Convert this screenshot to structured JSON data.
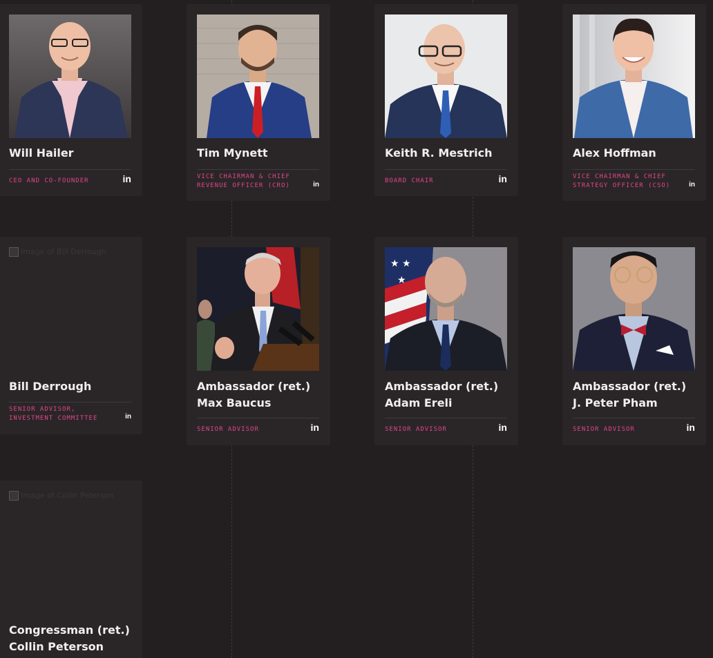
{
  "team": [
    {
      "name": "Will Hailer",
      "role": "CEO AND CO-FOUNDER",
      "linkedin": "in"
    },
    {
      "name": "Tim Mynett",
      "role": "VICE CHAIRMAN & CHIEF REVENUE OFFICER (CRO)",
      "linkedin": "in"
    },
    {
      "name": "Keith R. Mestrich",
      "role": "BOARD CHAIR",
      "linkedin": "in"
    },
    {
      "name": "Alex Hoffman",
      "role": "VICE CHAIRMAN & CHIEF STRATEGY OFFICER (CSO)",
      "linkedin": "in"
    },
    {
      "name": "Bill Derrough",
      "role": "SENIOR ADVISOR, INVESTMENT COMMITTEE",
      "linkedin": "in",
      "photo_alt": "Image of Bill Derrough"
    },
    {
      "name": "Ambassador (ret.) Max Baucus",
      "role": "SENIOR ADVISOR",
      "linkedin": "in"
    },
    {
      "name": "Ambassador (ret.) Adam Ereli",
      "role": "SENIOR ADVISOR",
      "linkedin": "in"
    },
    {
      "name": "Ambassador (ret.) J. Peter Pham",
      "role": "SENIOR ADVISOR",
      "linkedin": "in"
    },
    {
      "name": "Congressman (ret.) Collin Peterson",
      "role": "",
      "photo_alt": "Image of Collin Peterson"
    }
  ],
  "colors": {
    "background": "#231f20",
    "card": "#2a2627",
    "accent": "#e0458c",
    "text": "#f2eeef"
  }
}
